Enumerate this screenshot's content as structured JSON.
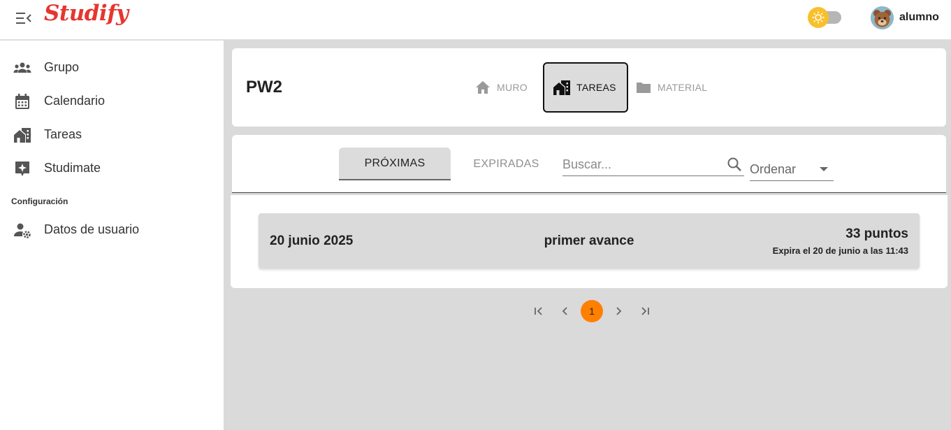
{
  "app": {
    "logo": "Studify"
  },
  "header": {
    "username": "alumno"
  },
  "sidebar": {
    "items": [
      {
        "label": "Grupo",
        "icon": "group-icon"
      },
      {
        "label": "Calendario",
        "icon": "calendar-icon"
      },
      {
        "label": "Tareas",
        "icon": "tasks-icon"
      },
      {
        "label": "Studimate",
        "icon": "sparkle-icon"
      }
    ],
    "section_title": "Configuración",
    "settings_items": [
      {
        "label": "Datos de usuario",
        "icon": "user-settings-icon"
      }
    ]
  },
  "course": {
    "title": "PW2",
    "tabs": [
      {
        "label": "MURO",
        "icon": "home-icon"
      },
      {
        "label": "TAREAS",
        "icon": "tasks-icon",
        "active": true
      },
      {
        "label": "MATERIAL",
        "icon": "folder-icon"
      }
    ]
  },
  "filters": {
    "tabs": [
      {
        "label": "PRÓXIMAS",
        "active": true
      },
      {
        "label": "EXPIRADAS"
      }
    ],
    "search_placeholder": "Buscar...",
    "sort_label": "Ordenar"
  },
  "tasks": [
    {
      "date": "20 junio 2025",
      "name": "primer avance",
      "points": "33 puntos",
      "expires": "Expira el 20 de junio a las 11:43"
    }
  ],
  "pagination": {
    "current_page": "1"
  },
  "colors": {
    "accent": "#ff8000",
    "logo": "#e5362f",
    "theme_knob": "#f9c02d"
  }
}
